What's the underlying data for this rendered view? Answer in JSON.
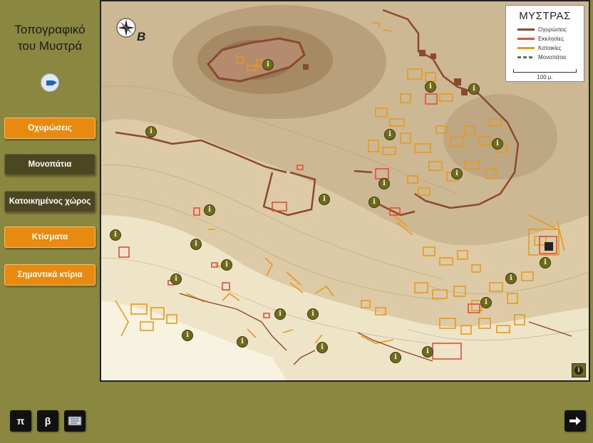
{
  "sidebar": {
    "title_line1": "Τοπογραφικό",
    "title_line2": "του Μυστρά",
    "video_icon": "video-camera-icon",
    "buttons": [
      {
        "label": "Οχυρώσεις",
        "style": "orange"
      },
      {
        "label": "Μονοπάτια",
        "style": "dark"
      },
      {
        "label": "Κατοικημένος χώρος",
        "style": "dark"
      },
      {
        "label": "Κτίσματα",
        "style": "orange"
      },
      {
        "label": "Σημαντικά κτίρια",
        "style": "orange"
      }
    ]
  },
  "map": {
    "compass_label": "B",
    "legend": {
      "title": "ΜΥΣΤΡΑΣ",
      "items": [
        {
          "label": "Οχυρώσεις",
          "color": "#8b4a2b"
        },
        {
          "label": "Εκκλησίες",
          "color": "#e0503a"
        },
        {
          "label": "Κατοικίες",
          "color": "#e89a1a"
        },
        {
          "label": "Μονοπάτια",
          "color": "#666666"
        }
      ],
      "scale_label": "100 μ."
    },
    "info_marker_icon": "info-icon",
    "info_marker_count": 30
  },
  "footer": {
    "btn_p": "π",
    "btn_b": "β",
    "book_icon": "book-icon",
    "next_icon": "arrow-right-icon"
  },
  "colors": {
    "background": "#8a8740",
    "accent_orange": "#e98a10",
    "button_dark": "#4b4722",
    "marker": "#6e6a1e"
  }
}
